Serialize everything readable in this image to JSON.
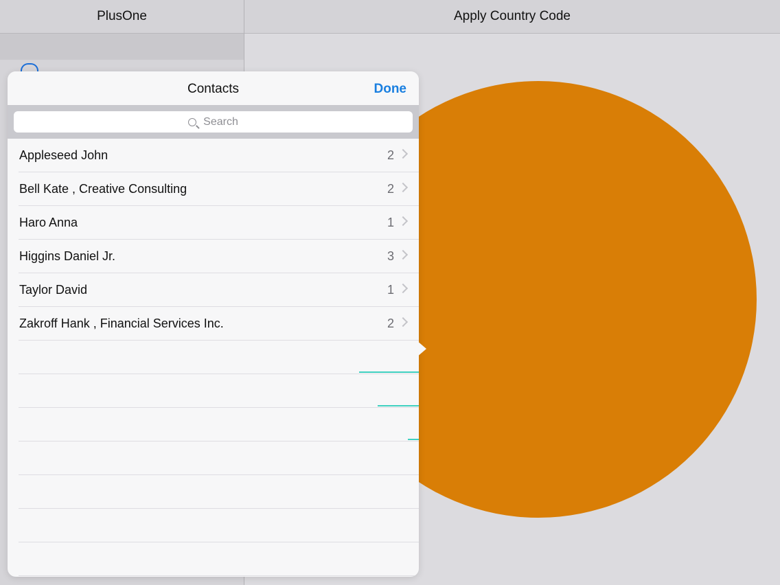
{
  "left_nav": {
    "title": "PlusOne"
  },
  "right_nav": {
    "title": "Apply Country Code"
  },
  "popover": {
    "title": "Contacts",
    "done_label": "Done",
    "search_placeholder": "Search",
    "contacts": [
      {
        "name": "Appleseed John",
        "count": "2"
      },
      {
        "name": "Bell Kate , Creative Consulting",
        "count": "2"
      },
      {
        "name": "Haro Anna",
        "count": "1"
      },
      {
        "name": "Higgins Daniel Jr.",
        "count": "3"
      },
      {
        "name": "Taylor David",
        "count": "1"
      },
      {
        "name": "Zakroff Hank , Financial Services Inc.",
        "count": "2"
      }
    ]
  },
  "colors": {
    "accent": "#1a7fe0",
    "overlay_circle": "#d97e06",
    "teal_marks": "#3fd0c0"
  }
}
